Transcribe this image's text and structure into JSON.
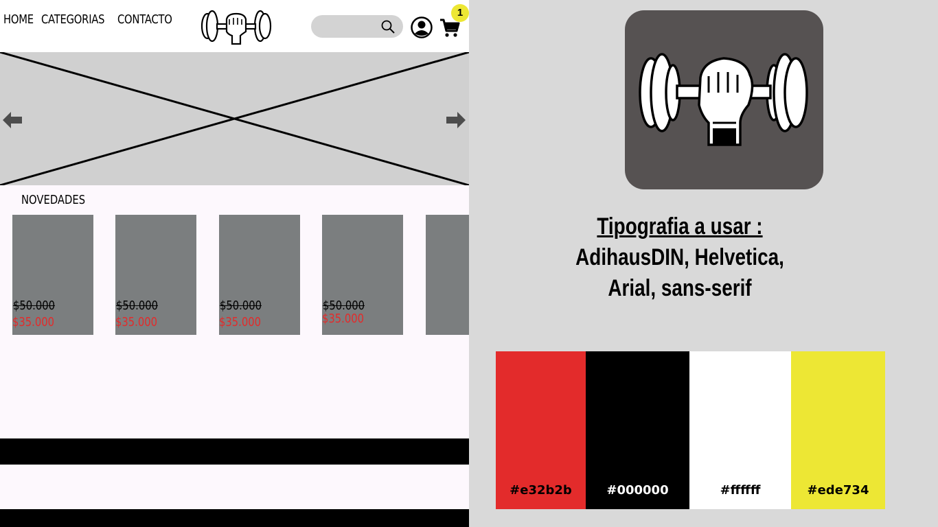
{
  "nav": {
    "items": [
      "HOME",
      "CATEGORIAS",
      "CONTACTO"
    ]
  },
  "header": {
    "logo_icon": "dumbbell-fist-icon",
    "search_icon": "search-icon",
    "user_icon": "user-icon",
    "cart_icon": "cart-icon",
    "cart_count": "1"
  },
  "hero": {
    "prev_icon": "arrow-left-icon",
    "next_icon": "arrow-right-icon"
  },
  "novedades": {
    "title": "NOVEDADES",
    "products": [
      {
        "old_price": "$50.000",
        "new_price": "$35.000"
      },
      {
        "old_price": "$50.000",
        "new_price": "$35.000"
      },
      {
        "old_price": "$50.000",
        "new_price": "$35.000"
      },
      {
        "old_price": "$50.000",
        "new_price": "$35.000"
      }
    ]
  },
  "typography": {
    "heading": "Tipografia a usar :",
    "line1": "AdihausDIN, Helvetica,",
    "line2": "Arial, sans-serif"
  },
  "palette": [
    {
      "label": "#e32b2b",
      "color": "#e32b2b",
      "text_color": "#000000"
    },
    {
      "label": "#000000",
      "color": "#000000",
      "text_color": "#ffffff"
    },
    {
      "label": "#ffffff",
      "color": "#ffffff",
      "text_color": "#000000"
    },
    {
      "label": "#ede734",
      "color": "#ede734",
      "text_color": "#000000"
    }
  ]
}
